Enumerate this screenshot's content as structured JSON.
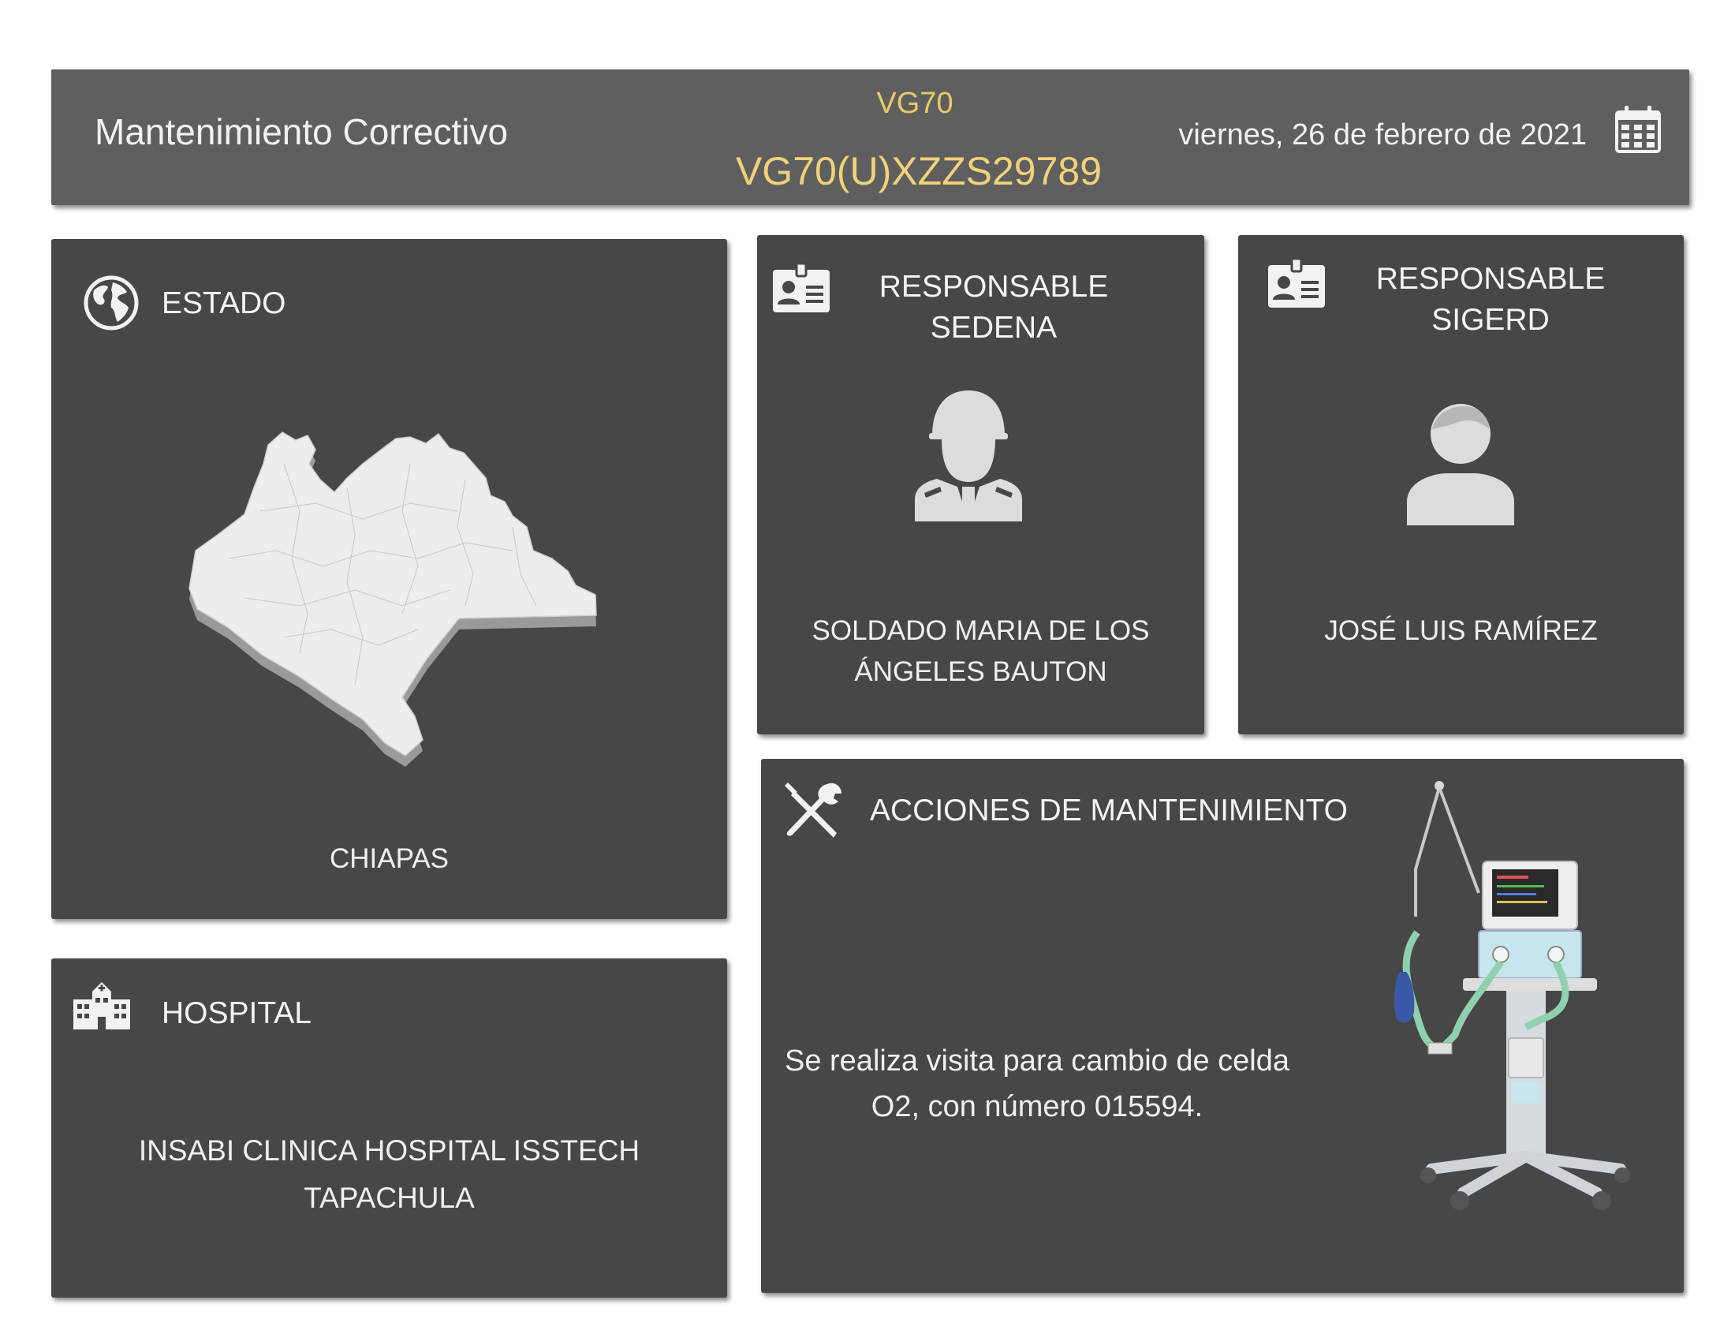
{
  "header": {
    "title": "Mantenimiento Correctivo",
    "model": "VG70",
    "serial": "VG70(U)XZZS29789",
    "date": "viernes, 26 de febrero de 2021",
    "calendar_icon": "calendar-icon"
  },
  "estado": {
    "title": "ESTADO",
    "value": "CHIAPAS",
    "icon": "globe-icon"
  },
  "responsable_sedena": {
    "title_line1": "RESPONSABLE",
    "title_line2": "SEDENA",
    "name_line1": "SOLDADO MARIA DE LOS",
    "name_line2": "ÁNGELES BAUTON",
    "icon": "id-card-icon",
    "avatar": "soldier-avatar-icon"
  },
  "responsable_sigerd": {
    "title_line1": "RESPONSABLE",
    "title_line2": "SIGERD",
    "name": "JOSÉ LUIS RAMÍREZ",
    "icon": "id-card-icon",
    "avatar": "person-avatar-icon"
  },
  "hospital": {
    "title": "HOSPITAL",
    "name_line1": "INSABI CLINICA HOSPITAL ISSTECH",
    "name_line2": "TAPACHULA",
    "icon": "hospital-icon"
  },
  "acciones": {
    "title": "ACCIONES DE MANTENIMIENTO",
    "text_line1": "Se realiza visita para cambio de celda",
    "text_line2": "O2, con número 015594.",
    "icon": "tools-icon",
    "image": "ventilator-image"
  },
  "colors": {
    "card_bg": "#474747",
    "header_bg": "#5f5f5f",
    "accent_gold": "#f0d27a",
    "text_light": "#f2f2f2"
  }
}
